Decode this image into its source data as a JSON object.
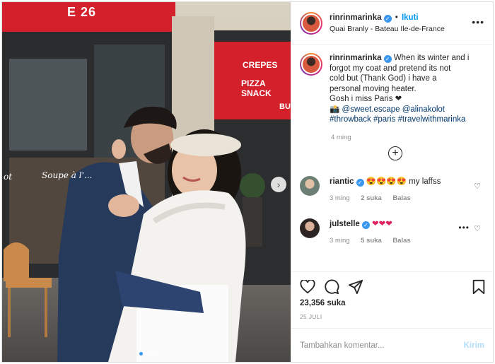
{
  "post": {
    "photo_alt": "couple embracing in front of a Paris cafe",
    "signs": {
      "awning_top": "E 26",
      "side_awning_line1": "CREPES",
      "side_awning_line2": "PIZZA SNACK",
      "side_awning_line3": "BUR",
      "window_script": "Soupe à l'...",
      "window_script2": "ot"
    },
    "carousel": {
      "slides": 3,
      "active": 1
    }
  },
  "header": {
    "username": "rinrinmarinka",
    "separator": "•",
    "follow_label": "Ikuti",
    "location": "Quai Branly - Bateau Ile-de-France",
    "more_icon": "more-horizontal-icon"
  },
  "caption": {
    "username": "rinrinmarinka",
    "text_lines": [
      "When its winter and i",
      "forgot my coat and pretend its not",
      "cold but (Thank God) i have a",
      "personal moving heater.",
      "Gosh i miss Paris ❤"
    ],
    "camera_emoji": "📸",
    "mention1": "@sweet.escape",
    "mention2": "@alinakolot",
    "hashtags": "#throwback #paris #travelwithmarinka",
    "time": "4 ming"
  },
  "comments": [
    {
      "username": "riantic",
      "text": "😍😍😍😍 my laffss",
      "time": "3 ming",
      "likes": "2 suka",
      "reply": "Balas"
    },
    {
      "username": "julstelle",
      "text": "❤❤❤",
      "time": "3 ming",
      "likes": "5 suka",
      "reply": "Balas"
    }
  ],
  "actions": {
    "likes": "23,356 suka",
    "date": "25 JULI"
  },
  "add_comment": {
    "placeholder": "Tambahkan komentar...",
    "post_label": "Kirim"
  },
  "colors": {
    "accent": "#0095f6",
    "verified": "#3897f0",
    "awning_red": "#d3202a",
    "muted": "#8e8e8e"
  }
}
